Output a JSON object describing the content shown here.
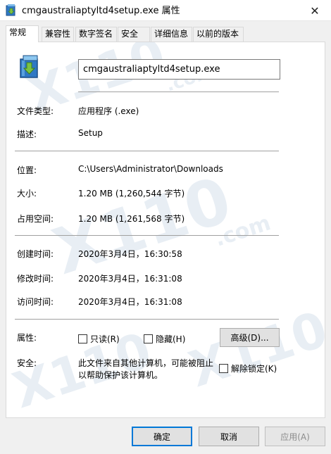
{
  "window": {
    "title": "cmgaustraliaptyltd4setup.exe 属性",
    "close_glyph": "✕"
  },
  "tabs": [
    {
      "label": "常规",
      "active": true
    },
    {
      "label": "兼容性"
    },
    {
      "label": "数字签名"
    },
    {
      "label": "安全"
    },
    {
      "label": "详细信息"
    },
    {
      "label": "以前的版本"
    }
  ],
  "general": {
    "file_name": "cmgaustraliaptyltd4setup.exe",
    "file_type_label": "文件类型:",
    "file_type_value": "应用程序 (.exe)",
    "description_label": "描述:",
    "description_value": "Setup",
    "location_label": "位置:",
    "location_value": "C:\\Users\\Administrator\\Downloads",
    "size_label": "大小:",
    "size_value": "1.20 MB (1,260,544 字节)",
    "size_on_disk_label": "占用空间:",
    "size_on_disk_value": "1.20 MB (1,261,568 字节)",
    "created_label": "创建时间:",
    "created_value": "2020年3月4日，16:30:58",
    "modified_label": "修改时间:",
    "modified_value": "2020年3月4日，16:31:08",
    "accessed_label": "访问时间:",
    "accessed_value": "2020年3月4日，16:31:08",
    "attributes_label": "属性:",
    "readonly_label": "只读(R)",
    "hidden_label": "隐藏(H)",
    "advanced_button": "高级(D)...",
    "security_label": "安全:",
    "security_text_line1": "此文件来自其他计算机，可能被阻止",
    "security_text_line2": "以帮助保护该计算机。",
    "unblock_label": "解除锁定(K)"
  },
  "buttons": {
    "ok": "确定",
    "cancel": "取消",
    "apply": "应用(A)"
  },
  "colors": {
    "accent": "#0078d7",
    "watermark": "#e6eef5"
  }
}
